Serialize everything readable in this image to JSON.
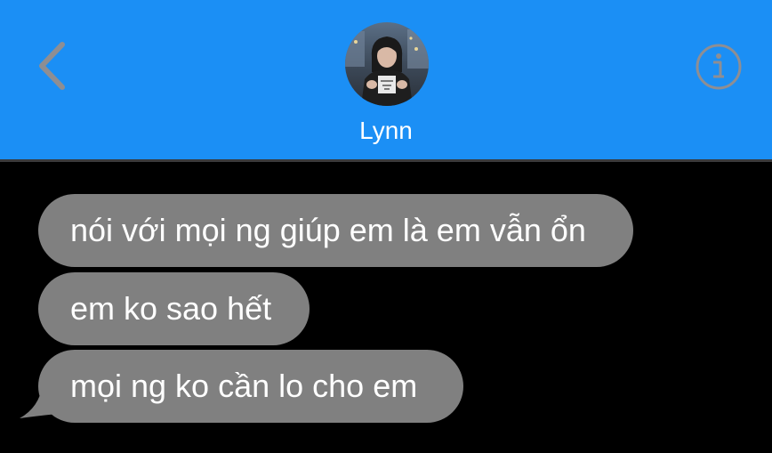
{
  "header": {
    "background_color": "#1b8ff5",
    "back_icon": "chevron-left-icon",
    "info_icon": "info-icon",
    "contact_name": "Lynn"
  },
  "messages": [
    {
      "sender": "contact",
      "text": "nói với mọi ng giúp em là em vẫn ổn"
    },
    {
      "sender": "contact",
      "text": "em ko sao hết"
    },
    {
      "sender": "contact",
      "text": "mọi ng ko cần lo cho em"
    }
  ],
  "colors": {
    "incoming_bubble": "#808080",
    "background": "#000000",
    "icon_gray": "#8e8e93"
  }
}
